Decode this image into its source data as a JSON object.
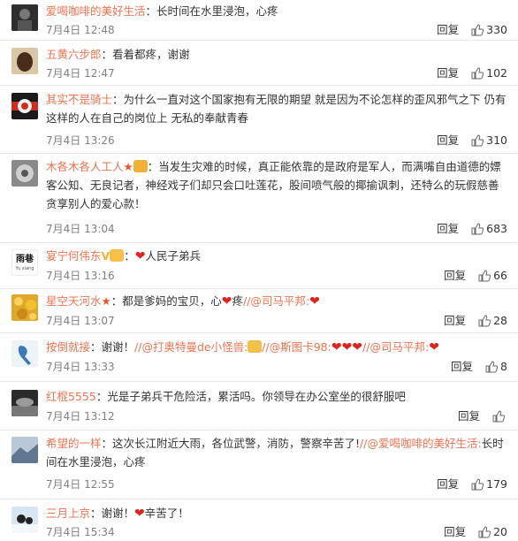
{
  "comments": [
    {
      "user": "爱喝咖啡的美好生活",
      "text": "：长时间在水里浸泡，心疼",
      "time": "7月4日 12:48",
      "reply": "回复",
      "likes": "330",
      "avatar_color": "#3a3a3a"
    },
    {
      "user": "五黄六步郎",
      "text": "：看着都疼，谢谢",
      "time": "7月4日 12:47",
      "reply": "回复",
      "likes": "102",
      "avatar_color": "#5a3b2a"
    },
    {
      "user": "其实不是骑士",
      "text": "：为什么一直对这个国家抱有无限的期望 就是因为不论怎样的歪风邪气之下 仍有这样的人在自己的岗位上 无私的奉献青春",
      "time": "7月4日 13:26",
      "reply": "回复",
      "likes": "310",
      "avatar_color": "#c0392b"
    },
    {
      "user": "木各木各人工人",
      "text": "：当发生灾难的时候，真正能依靠的是政府是军人，而满嘴自由道德的嫖客公知、无良记者，神经戏子们却只会口吐莲花，股间喷气般的揶揄讽刺，还特么的玩假慈善贪享别人的爱心款！",
      "time": "7月4日 13:04",
      "reply": "回复",
      "likes": "683",
      "avatar_color": "#6b6b6b"
    },
    {
      "user": "宴宁何伟东",
      "text": "人民子弟兵",
      "time": "7月4日 13:16",
      "reply": "回复",
      "likes": "66",
      "avatar_label": "雨巷",
      "avatar_sub": "Yu xiang"
    },
    {
      "user": "星空天河水",
      "text1": "：都是爹妈的宝贝，心",
      "text2": "疼",
      "mention": "//@司马平邦:",
      "time": "7月4日 13:07",
      "reply": "回复",
      "likes": "28",
      "avatar_color": "#e6b422"
    },
    {
      "user": "按倒就接",
      "text": "：谢谢！",
      "mention1": "//@打奥特曼de小怪兽:",
      "mention2": "//@斯图卡98:",
      "mention3": "//@司马平邦:",
      "time": "7月4日 13:33",
      "reply": "回复",
      "likes": "8",
      "avatar_color": "#e8eef5"
    },
    {
      "user": "红棍5555",
      "text": "：光是子弟兵干危险活，累活吗。你领导在办公室坐的很舒服吧",
      "time": "7月4日 13:12",
      "reply": "回复",
      "likes": "",
      "avatar_color": "#444444"
    },
    {
      "user": "希望的一样",
      "text1": "：这次长江附近大雨，各位武警，消防，警察辛苦了!",
      "mention": "//@爱喝咖啡的美好生活:",
      "text2": "长时间在水里浸泡，心疼",
      "time": "7月4日 12:55",
      "reply": "回复",
      "likes": "179",
      "avatar_color": "#8aa0b8"
    },
    {
      "user": "三月上京",
      "text1": "：谢谢！",
      "text2": "辛苦了！",
      "time": "7月4日 15:34",
      "reply": "回复",
      "likes": "20",
      "avatar_color": "#a8c4dc"
    }
  ],
  "colors": {
    "username": "#eb7350",
    "heart": "#e0231c"
  }
}
